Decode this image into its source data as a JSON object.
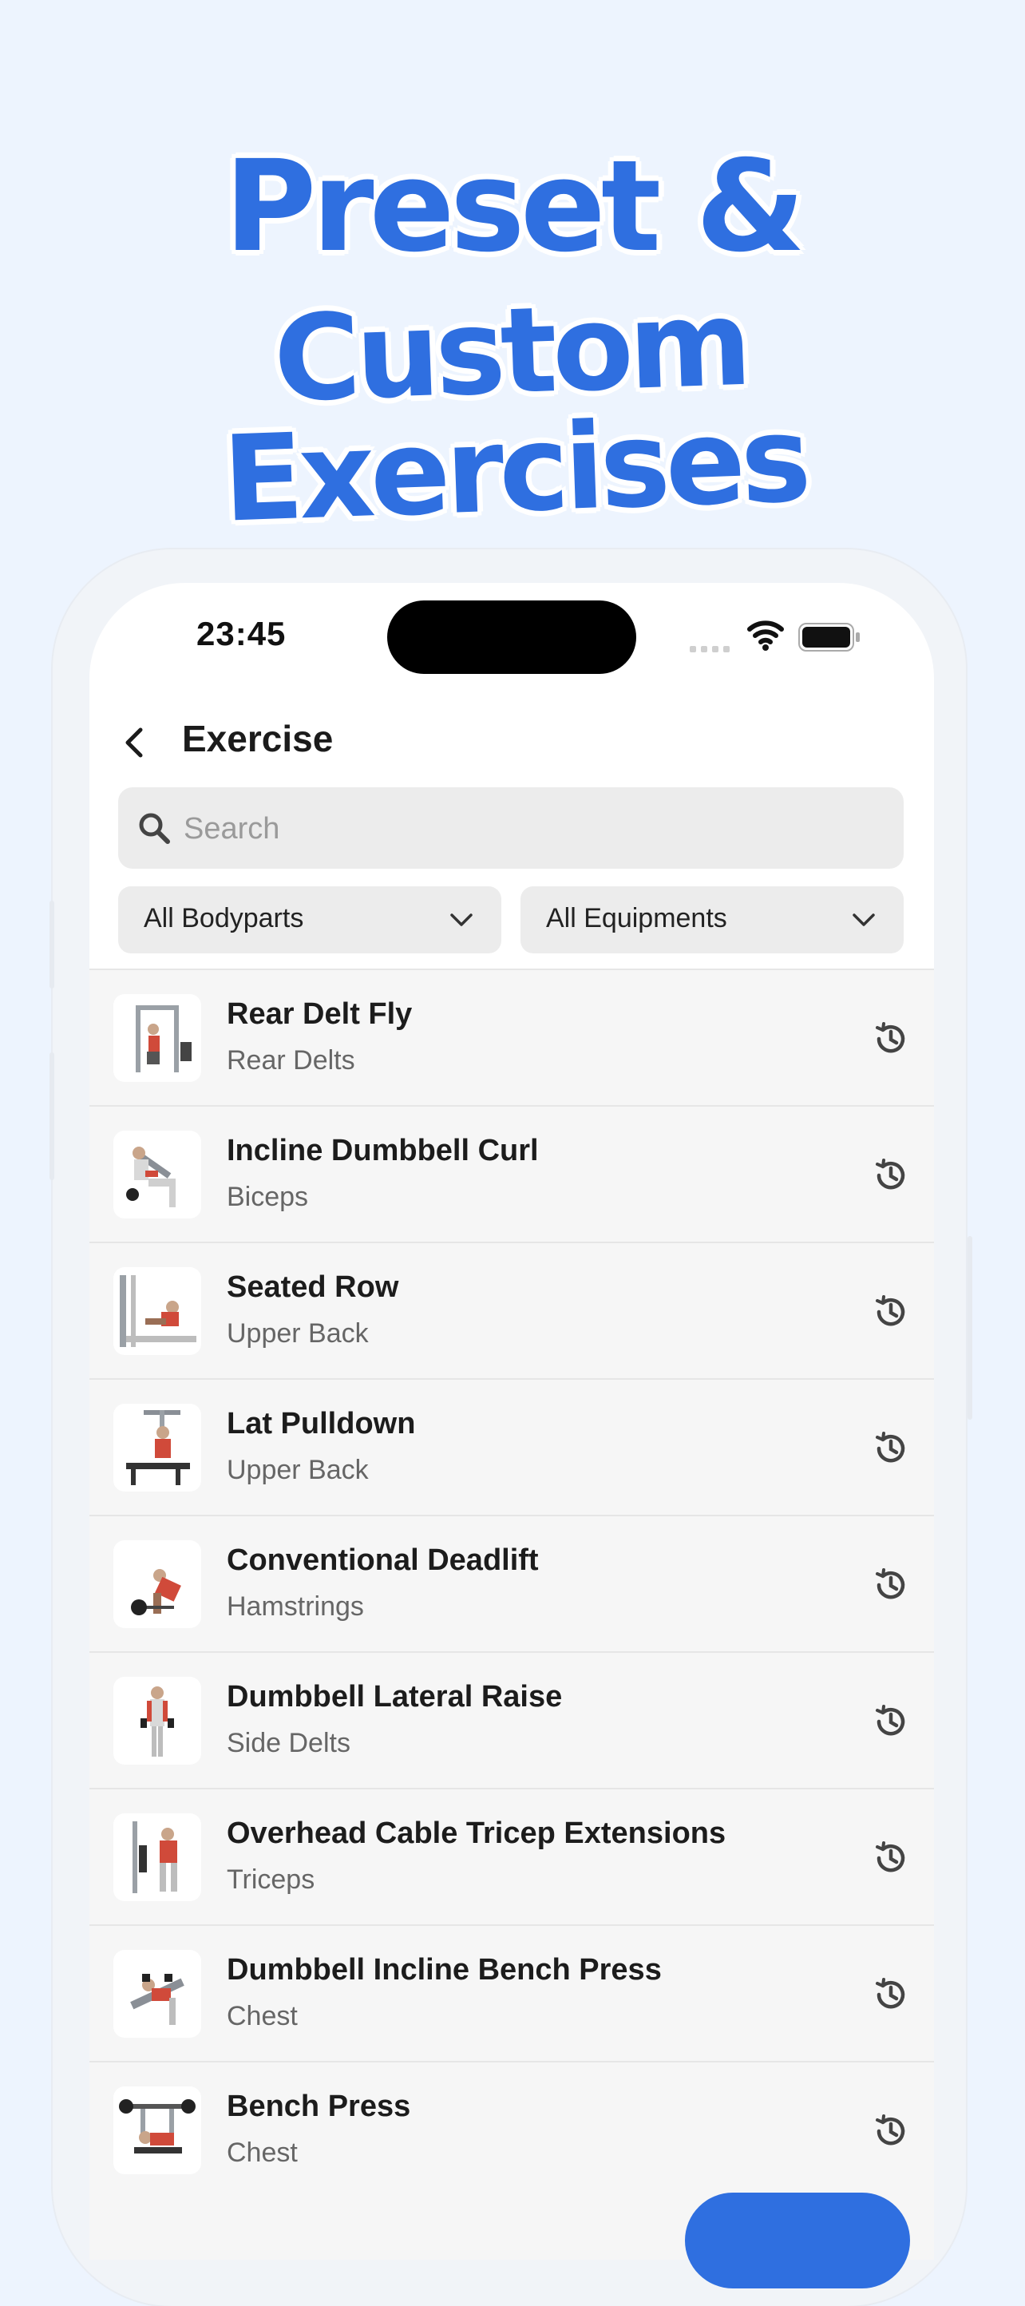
{
  "headline": {
    "line1": "Preset  &",
    "line2": "Custom Exercises"
  },
  "status_bar": {
    "time": "23:45"
  },
  "nav": {
    "title": "Exercise",
    "back_icon": "chevron-left-icon"
  },
  "search": {
    "placeholder": "Search",
    "value": ""
  },
  "filters": [
    {
      "label": "All Bodyparts"
    },
    {
      "label": "All Equipments"
    }
  ],
  "exercises": [
    {
      "name": "Rear Delt Fly",
      "bodypart": "Rear Delts"
    },
    {
      "name": "Incline Dumbbell Curl",
      "bodypart": "Biceps"
    },
    {
      "name": "Seated Row",
      "bodypart": "Upper Back"
    },
    {
      "name": "Lat Pulldown",
      "bodypart": "Upper Back"
    },
    {
      "name": "Conventional Deadlift",
      "bodypart": "Hamstrings"
    },
    {
      "name": "Dumbbell Lateral Raise",
      "bodypart": "Side Delts"
    },
    {
      "name": "Overhead Cable Tricep Extensions",
      "bodypart": "Triceps"
    },
    {
      "name": "Dumbbell Incline Bench Press",
      "bodypart": "Chest"
    },
    {
      "name": "Bench Press",
      "bodypart": "Chest"
    }
  ],
  "colors": {
    "accent": "#2f6fe0",
    "background": "#edf4fe"
  }
}
